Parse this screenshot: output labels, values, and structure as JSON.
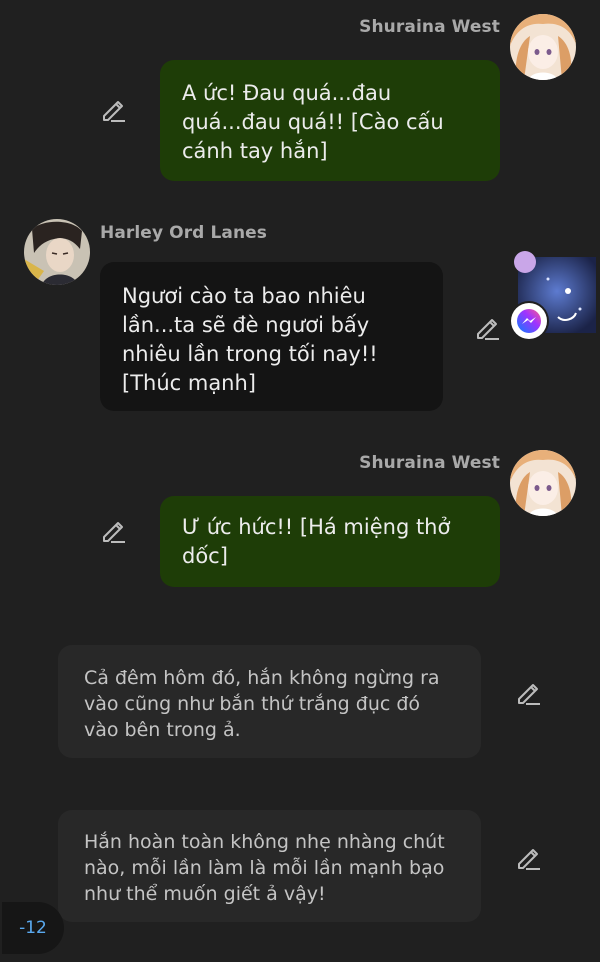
{
  "messages": [
    {
      "sender": "Shuraina West",
      "side": "right",
      "text": "A ức! Đau quá...đau\nquá...đau quá!! [Cào cấu\ncánh tay hắn]"
    },
    {
      "sender": "Harley Ord Lanes",
      "side": "left",
      "text": "Ngươi cào ta bao nhiêu\nlần...ta sẽ đè ngươi bấy\nnhiêu lần trong tối nay!!\n[Thúc mạnh]"
    },
    {
      "sender": "Shuraina West",
      "side": "right",
      "text": "Ư ức hức!! [Há miệng thở\ndốc]"
    },
    {
      "sender": "",
      "side": "narration",
      "text": "Cả đêm hôm đó, hắn không ngừng ra\nvào cũng như bắn thứ trắng đục đó\nvào bên trong ả."
    },
    {
      "sender": "",
      "side": "narration",
      "text": "Hắn hoàn toàn không nhẹ nhàng chút\nnào, mỗi lần làm là mỗi lần mạnh bạo\nnhư thể muốn giết ả vậy!"
    }
  ],
  "counter": "-12",
  "icons": {
    "edit": "pencil-edit-icon",
    "chat_head_badge": "messenger-icon"
  },
  "colors": {
    "background": "#202020",
    "own_bubble": "#1e3d07",
    "other_bubble": "#141414",
    "narration_bubble": "#282828",
    "counter_text": "#5aa9ef"
  }
}
